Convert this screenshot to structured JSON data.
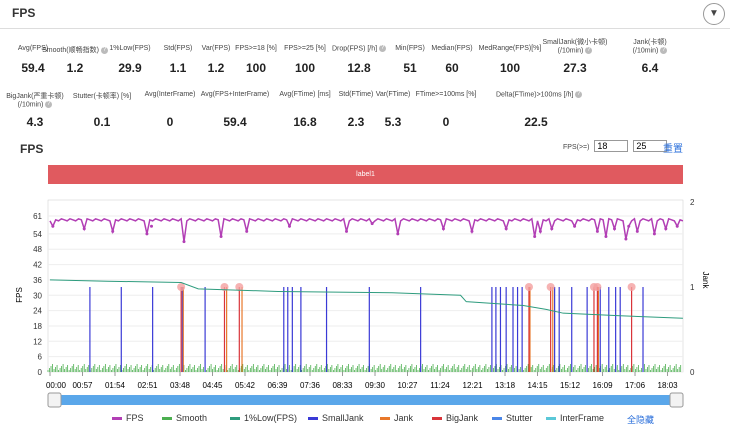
{
  "header": {
    "title": "FPS",
    "collapse_icon": "chevron-down-icon"
  },
  "stats_row1": [
    {
      "label": "Avg(FPS)",
      "value": "59.4"
    },
    {
      "label": "Smooth(顺畅指数)",
      "value": "1.2",
      "help": true
    },
    {
      "label": "1%Low(FPS)",
      "value": "29.9"
    },
    {
      "label": "Std(FPS)",
      "value": "1.1"
    },
    {
      "label": "Var(FPS)",
      "value": "1.2"
    },
    {
      "label": "FPS>=18 [%]",
      "value": "100"
    },
    {
      "label": "FPS>=25 [%]",
      "value": "100"
    },
    {
      "label": "Drop(FPS) [/h]",
      "value": "12.8",
      "help": true
    },
    {
      "label": "Min(FPS)",
      "value": "51"
    },
    {
      "label": "Median(FPS)",
      "value": "60"
    },
    {
      "label": "MedRange(FPS)[%]",
      "value": "100"
    },
    {
      "label": "SmallJank(微小卡顿)",
      "label2": "(/10min)",
      "value": "27.3",
      "help": true
    },
    {
      "label": "Jank(卡顿)",
      "label2": "(/10min)",
      "value": "6.4",
      "help": true
    }
  ],
  "stats_row2": [
    {
      "label": "BigJank(严重卡顿)",
      "label2": "(/10min)",
      "value": "4.3",
      "help": true
    },
    {
      "label": "Stutter(卡顿率) [%]",
      "value": "0.1"
    },
    {
      "label": "Avg(InterFrame)",
      "value": "0"
    },
    {
      "label": "Avg(FPS+InterFrame)",
      "value": "59.4"
    },
    {
      "label": "Avg(FTime) [ms]",
      "value": "16.8"
    },
    {
      "label": "Std(FTime)",
      "value": "2.3"
    },
    {
      "label": "Var(FTime)",
      "value": "5.3"
    },
    {
      "label": "FTime>=100ms [%]",
      "value": "0"
    },
    {
      "label": "Delta(FTime)>100ms [/h]",
      "value": "22.5",
      "help": true
    }
  ],
  "chart_title": "FPS",
  "threshold": {
    "label": "FPS(>=)",
    "v1": "18",
    "v2": "25",
    "reset": "重置"
  },
  "band_label": "label1",
  "chart_data": {
    "type": "line",
    "xlabel": "",
    "ylabel": "FPS",
    "y2label": "Jank",
    "ylim": [
      0,
      61
    ],
    "y2lim": [
      0,
      2
    ],
    "yticks": [
      "61",
      "54",
      "48",
      "42",
      "36",
      "30",
      "24",
      "18",
      "12",
      "6",
      "0"
    ],
    "y2ticks": [
      "2",
      "1",
      "0"
    ],
    "xticks": [
      "00:00",
      "00:57",
      "01:54",
      "02:51",
      "03:48",
      "04:45",
      "05:42",
      "06:39",
      "07:36",
      "08:33",
      "09:30",
      "10:27",
      "11:24",
      "12:21",
      "13:18",
      "14:15",
      "15:12",
      "16:09",
      "17:06",
      "18:03"
    ],
    "duration_s": 1110,
    "fps_typical": 59.5,
    "fps_dips": [
      [
        5,
        57
      ],
      [
        60,
        56
      ],
      [
        110,
        55
      ],
      [
        170,
        54
      ],
      [
        178,
        57
      ],
      [
        235,
        51
      ],
      [
        300,
        53
      ],
      [
        345,
        55
      ],
      [
        420,
        57
      ],
      [
        520,
        55
      ],
      [
        565,
        58
      ],
      [
        610,
        54
      ],
      [
        690,
        56
      ],
      [
        740,
        55
      ],
      [
        800,
        56
      ],
      [
        850,
        53
      ],
      [
        860,
        55
      ],
      [
        880,
        56
      ],
      [
        920,
        57
      ],
      [
        960,
        55
      ],
      [
        975,
        53
      ],
      [
        990,
        56
      ],
      [
        1010,
        52
      ],
      [
        1015,
        57
      ],
      [
        1030,
        55
      ],
      [
        1060,
        54
      ],
      [
        1080,
        56
      ],
      [
        1100,
        57
      ]
    ],
    "low1_series": [
      [
        0,
        36
      ],
      [
        100,
        35.5
      ],
      [
        230,
        35
      ],
      [
        260,
        32.5
      ],
      [
        400,
        31.5
      ],
      [
        600,
        31
      ],
      [
        720,
        30
      ],
      [
        730,
        27.5
      ],
      [
        830,
        26
      ],
      [
        870,
        24.5
      ],
      [
        900,
        23
      ],
      [
        1000,
        22
      ],
      [
        1110,
        21
      ]
    ],
    "smalljank_s": [
      70,
      125,
      180,
      232,
      272,
      410,
      417,
      425,
      440,
      485,
      560,
      650,
      775,
      782,
      790,
      800,
      812,
      820,
      828,
      885,
      893,
      915,
      942,
      965,
      980,
      992,
      1000,
      1040
    ],
    "jank_s": [
      232,
      308,
      335,
      840,
      880,
      960
    ],
    "bigjank_s": [
      230,
      306,
      332,
      840,
      878,
      954,
      960,
      1020
    ],
    "legend": [
      {
        "name": "FPS",
        "color": "#b23fb5"
      },
      {
        "name": "Smooth",
        "color": "#4caf50"
      },
      {
        "name": "1%Low(FPS)",
        "color": "#2e9c7e"
      },
      {
        "name": "SmallJank",
        "color": "#3a3ad6"
      },
      {
        "name": "Jank",
        "color": "#e8782a"
      },
      {
        "name": "BigJank",
        "color": "#d9343a"
      },
      {
        "name": "Stutter",
        "color": "#4a86e8"
      },
      {
        "name": "InterFrame",
        "color": "#5bc8d8"
      }
    ],
    "hide_all": "全隐藏"
  }
}
